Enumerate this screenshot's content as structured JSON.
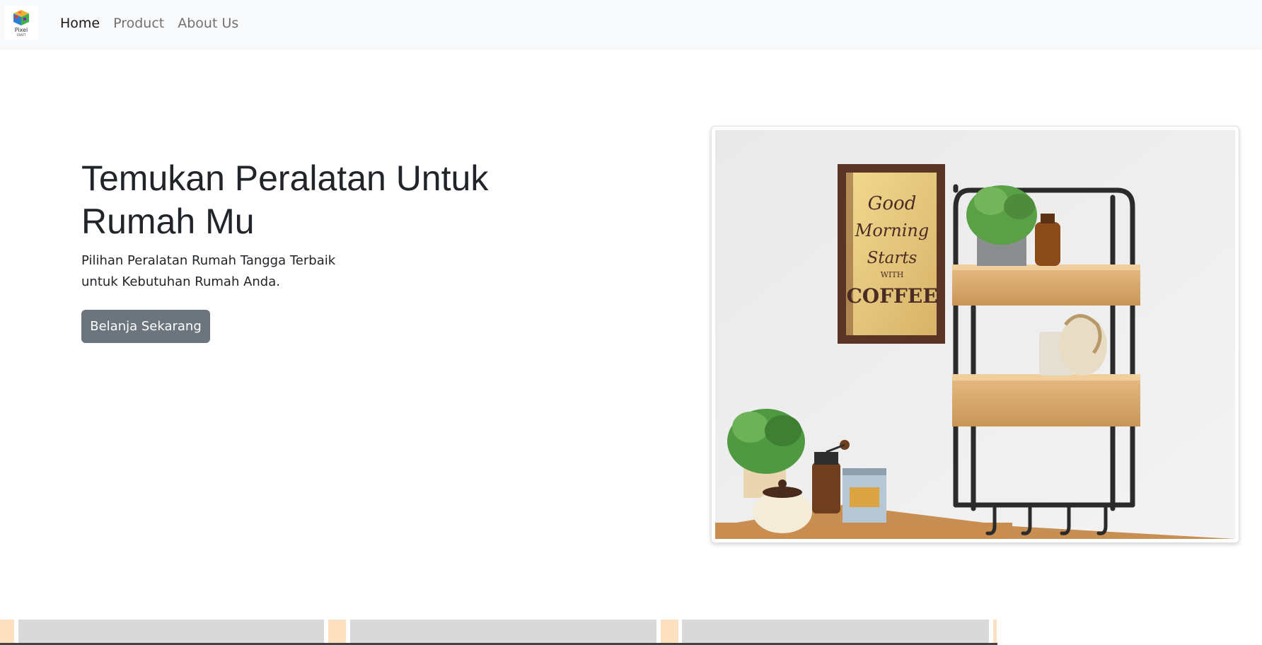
{
  "navbar": {
    "brand": {
      "name": "Pixel",
      "sub": "CRAFT"
    },
    "links": [
      {
        "label": "Home",
        "active": true
      },
      {
        "label": "Product",
        "active": false
      },
      {
        "label": "About Us",
        "active": false
      }
    ]
  },
  "hero": {
    "title_line1": "Temukan Peralatan Untuk",
    "title_line2": "Rumah Mu",
    "subtitle_line1": "Pilihan Peralatan Rumah Tangga Terbaik",
    "subtitle_line2": "untuk Kebutuhan Rumah Anda.",
    "cta_label": "Belanja Sekarang",
    "image_alt": "Wall shelf with plants, coffee poster and kitchen items",
    "poster_text": [
      "Good",
      "Morning",
      "Starts",
      "WITH",
      "COFFEE"
    ]
  },
  "colors": {
    "navbar_bg": "#f8f9fa",
    "button_bg": "#6c757d",
    "peach": "#fde0bf",
    "card_gray": "#d9d9d9"
  }
}
